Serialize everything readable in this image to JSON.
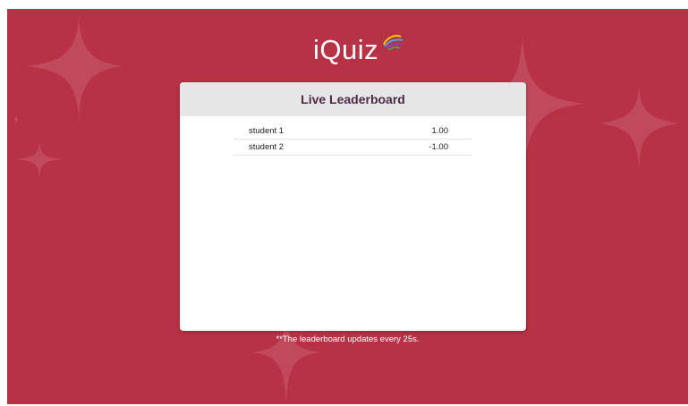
{
  "app": {
    "logo_text": "iQuiz"
  },
  "leaderboard": {
    "title": "Live Leaderboard",
    "rows": [
      {
        "name": "student 1",
        "score": "1.00"
      },
      {
        "name": "student 2",
        "score": "-1.00"
      }
    ],
    "footnote": "**The leaderboard updates every 25s."
  },
  "colors": {
    "background": "#b83245",
    "header": "#e6e6e6",
    "title_text": "#4b2a45"
  }
}
